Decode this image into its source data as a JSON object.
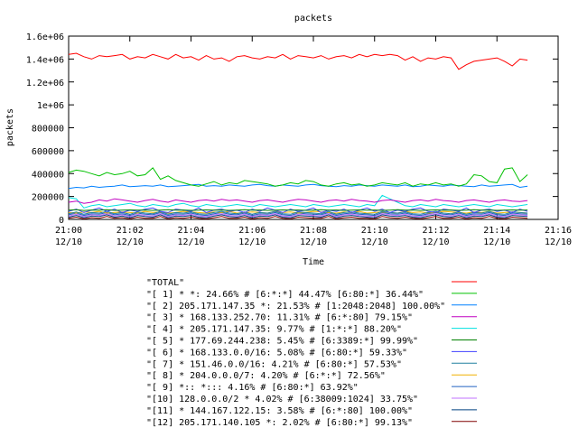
{
  "chart_data": {
    "type": "line",
    "title": "packets",
    "xlabel": "Time",
    "ylabel": "packets",
    "ylim": [
      0,
      1600000
    ],
    "y_ticks": [
      0,
      200000,
      400000,
      600000,
      800000,
      1000000,
      1200000,
      1400000,
      1600000
    ],
    "y_tick_labels": [
      "0",
      "200000",
      "400000",
      "600000",
      "800000",
      "1e+06",
      "1.2e+06",
      "1.4e+06",
      "1.6e+06"
    ],
    "xlim": [
      "21:00",
      "21:16"
    ],
    "x_ticks": [
      {
        "time": "21:00",
        "date": "12/10"
      },
      {
        "time": "21:02",
        "date": "12/10"
      },
      {
        "time": "21:04",
        "date": "12/10"
      },
      {
        "time": "21:06",
        "date": "12/10"
      },
      {
        "time": "21:08",
        "date": "12/10"
      },
      {
        "time": "21:10",
        "date": "12/10"
      },
      {
        "time": "21:12",
        "date": "12/10"
      },
      {
        "time": "21:14",
        "date": "12/10"
      },
      {
        "time": "21:16",
        "date": "12/10"
      }
    ],
    "grid": false,
    "legend_position": "bottom",
    "x_minutes": [
      0,
      0.25,
      0.5,
      0.75,
      1,
      1.25,
      1.5,
      1.75,
      2,
      2.25,
      2.5,
      2.75,
      3,
      3.25,
      3.5,
      3.75,
      4,
      4.25,
      4.5,
      4.75,
      5,
      5.25,
      5.5,
      5.75,
      6,
      6.25,
      6.5,
      6.75,
      7,
      7.25,
      7.5,
      7.75,
      8,
      8.25,
      8.5,
      8.75,
      9,
      9.25,
      9.5,
      9.75,
      10,
      10.25,
      10.5,
      10.75,
      11,
      11.25,
      11.5,
      11.75,
      12,
      12.25,
      12.5,
      12.75,
      13,
      13.25,
      13.5,
      13.75,
      14,
      14.25,
      14.5,
      14.75,
      15
    ],
    "series": [
      {
        "name": "\"TOTAL\"",
        "color": "#ff0000",
        "values": [
          1440000,
          1450000,
          1420000,
          1400000,
          1430000,
          1420000,
          1430000,
          1440000,
          1400000,
          1420000,
          1410000,
          1440000,
          1420000,
          1400000,
          1440000,
          1410000,
          1420000,
          1390000,
          1430000,
          1400000,
          1410000,
          1380000,
          1420000,
          1430000,
          1410000,
          1400000,
          1420000,
          1410000,
          1440000,
          1400000,
          1430000,
          1420000,
          1410000,
          1430000,
          1400000,
          1420000,
          1430000,
          1410000,
          1440000,
          1420000,
          1440000,
          1430000,
          1440000,
          1430000,
          1390000,
          1420000,
          1380000,
          1410000,
          1400000,
          1420000,
          1410000,
          1310000,
          1350000,
          1380000,
          1390000,
          1400000,
          1410000,
          1380000,
          1340000,
          1400000,
          1390000
        ]
      },
      {
        "name": "\"[ 1] * *: 24.66% # [6:*:*] 44.47% [6:80:*] 36.44%\"",
        "color": "#00c000",
        "values": [
          410000,
          430000,
          420000,
          400000,
          380000,
          410000,
          390000,
          400000,
          420000,
          380000,
          390000,
          450000,
          350000,
          380000,
          340000,
          320000,
          300000,
          290000,
          310000,
          330000,
          300000,
          320000,
          310000,
          340000,
          330000,
          320000,
          310000,
          290000,
          300000,
          320000,
          310000,
          340000,
          330000,
          300000,
          290000,
          310000,
          320000,
          300000,
          310000,
          290000,
          300000,
          320000,
          310000,
          300000,
          320000,
          290000,
          310000,
          300000,
          320000,
          300000,
          310000,
          290000,
          310000,
          390000,
          380000,
          330000,
          320000,
          440000,
          450000,
          330000,
          390000
        ]
      },
      {
        "name": "\"[ 2] 205.171.147.35 *: 21.53% # [1:2048:2048] 100.00%\"",
        "color": "#0080ff",
        "values": [
          270000,
          280000,
          275000,
          290000,
          280000,
          285000,
          290000,
          300000,
          285000,
          290000,
          295000,
          290000,
          300000,
          285000,
          290000,
          295000,
          300000,
          305000,
          290000,
          295000,
          290000,
          300000,
          295000,
          290000,
          300000,
          305000,
          295000,
          290000,
          300000,
          295000,
          290000,
          300000,
          305000,
          295000,
          290000,
          285000,
          295000,
          290000,
          300000,
          295000,
          290000,
          300000,
          295000,
          290000,
          300000,
          285000,
          290000,
          300000,
          295000,
          290000,
          300000,
          295000,
          290000,
          285000,
          300000,
          290000,
          295000,
          300000,
          305000,
          280000,
          290000
        ]
      },
      {
        "name": "\"[ 3] * 168.133.252.70: 11.31% # [6:*:80] 79.15%\"",
        "color": "#c000c0",
        "values": [
          150000,
          160000,
          140000,
          150000,
          170000,
          160000,
          180000,
          170000,
          160000,
          150000,
          165000,
          175000,
          160000,
          150000,
          170000,
          160000,
          150000,
          165000,
          170000,
          160000,
          175000,
          165000,
          170000,
          160000,
          150000,
          165000,
          170000,
          160000,
          150000,
          165000,
          175000,
          170000,
          160000,
          150000,
          165000,
          170000,
          160000,
          175000,
          165000,
          160000,
          150000,
          165000,
          170000,
          160000,
          150000,
          165000,
          170000,
          160000,
          175000,
          165000,
          160000,
          150000,
          165000,
          170000,
          160000,
          150000,
          165000,
          170000,
          160000,
          155000,
          165000
        ]
      },
      {
        "name": "\"[ 4] * 205.171.147.35: 9.77% # [1:*:*] 88.20%\"",
        "color": "#00e0e0",
        "values": [
          190000,
          180000,
          100000,
          120000,
          130000,
          110000,
          120000,
          130000,
          140000,
          120000,
          110000,
          130000,
          120000,
          110000,
          130000,
          140000,
          120000,
          110000,
          130000,
          120000,
          110000,
          120000,
          130000,
          120000,
          110000,
          130000,
          120000,
          110000,
          120000,
          130000,
          120000,
          110000,
          130000,
          120000,
          110000,
          120000,
          130000,
          120000,
          110000,
          130000,
          120000,
          210000,
          180000,
          150000,
          120000,
          110000,
          130000,
          120000,
          110000,
          130000,
          120000,
          110000,
          120000,
          130000,
          120000,
          110000,
          130000,
          120000,
          110000,
          120000,
          130000
        ]
      },
      {
        "name": "\"[ 5] * 177.69.244.238: 5.45% # [6:3389:*] 99.99%\"",
        "color": "#008000",
        "values": [
          80000,
          85000,
          78000,
          82000,
          80000,
          84000,
          79000,
          81000,
          83000,
          80000,
          82000,
          79000,
          81000,
          84000,
          80000,
          82000,
          79000,
          81000,
          83000,
          80000,
          82000,
          79000,
          81000,
          84000,
          80000,
          82000,
          79000,
          81000,
          83000,
          80000,
          82000,
          79000,
          81000,
          84000,
          80000,
          82000,
          79000,
          81000,
          83000,
          80000,
          82000,
          79000,
          81000,
          84000,
          80000,
          82000,
          79000,
          81000,
          83000,
          80000,
          82000,
          79000,
          81000,
          84000,
          80000,
          82000,
          79000,
          81000,
          83000,
          80000,
          82000
        ]
      },
      {
        "name": "\"[ 6] * 168.133.0.0/16: 5.08% # [6:80:*] 59.33%\"",
        "color": "#4040ff",
        "values": [
          70000,
          90000,
          60000,
          80000,
          100000,
          70000,
          90000,
          60000,
          80000,
          70000,
          90000,
          100000,
          70000,
          60000,
          90000,
          80000,
          70000,
          100000,
          60000,
          80000,
          90000,
          70000,
          80000,
          60000,
          90000,
          70000,
          100000,
          80000,
          60000,
          90000,
          70000,
          80000,
          100000,
          60000,
          80000,
          70000,
          90000,
          60000,
          80000,
          100000,
          70000,
          90000,
          60000,
          80000,
          70000,
          90000,
          100000,
          70000,
          60000,
          90000,
          80000,
          70000,
          100000,
          60000,
          80000,
          90000,
          70000,
          80000,
          60000,
          90000,
          70000
        ]
      },
      {
        "name": "\"[ 7] * 151.46.0.0/16: 4.21% # [6:80:*] 57.53%\"",
        "color": "#2080a0",
        "values": [
          50000,
          65000,
          45000,
          60000,
          55000,
          70000,
          50000,
          60000,
          45000,
          65000,
          55000,
          50000,
          70000,
          45000,
          60000,
          55000,
          65000,
          50000,
          45000,
          60000,
          70000,
          55000,
          50000,
          65000,
          45000,
          60000,
          55000,
          70000,
          50000,
          45000,
          65000,
          60000,
          55000,
          50000,
          70000,
          45000,
          60000,
          65000,
          55000,
          50000,
          45000,
          70000,
          60000,
          55000,
          65000,
          50000,
          45000,
          60000,
          70000,
          55000,
          50000,
          65000,
          45000,
          60000,
          55000,
          70000,
          50000,
          45000,
          65000,
          60000,
          55000
        ]
      },
      {
        "name": "\"[ 8] * 204.0.0.0/7: 4.20% # [6:*:*] 72.56%\"",
        "color": "#f0b000",
        "values": [
          60000,
          55000,
          65000,
          60000,
          70000,
          55000,
          60000,
          65000,
          60000,
          55000,
          70000,
          60000,
          65000,
          55000,
          60000,
          70000,
          65000,
          60000,
          55000,
          65000,
          60000,
          70000,
          55000,
          60000,
          65000,
          60000,
          55000,
          70000,
          60000,
          65000,
          55000,
          60000,
          70000,
          65000,
          60000,
          55000,
          65000,
          60000,
          70000,
          55000,
          60000,
          65000,
          60000,
          55000,
          70000,
          60000,
          65000,
          55000,
          60000,
          70000,
          65000,
          60000,
          55000,
          65000,
          60000,
          70000,
          55000,
          60000,
          65000,
          60000,
          55000
        ]
      },
      {
        "name": "\"[ 9] *:: *::: 4.16% # [6:80:*] 63.92%\"",
        "color": "#2060c0",
        "values": [
          40000,
          55000,
          35000,
          50000,
          45000,
          60000,
          40000,
          50000,
          35000,
          55000,
          45000,
          40000,
          60000,
          35000,
          50000,
          45000,
          55000,
          40000,
          35000,
          50000,
          60000,
          45000,
          40000,
          55000,
          35000,
          50000,
          45000,
          60000,
          40000,
          35000,
          55000,
          50000,
          45000,
          40000,
          60000,
          35000,
          50000,
          55000,
          45000,
          40000,
          35000,
          60000,
          50000,
          45000,
          55000,
          40000,
          35000,
          50000,
          60000,
          45000,
          40000,
          55000,
          35000,
          50000,
          45000,
          60000,
          40000,
          35000,
          55000,
          50000,
          45000
        ]
      },
      {
        "name": "\"[10] 128.0.0.0/2 * 4.02% # [6:38009:1024] 33.75%\"",
        "color": "#c070ff",
        "values": [
          30000,
          45000,
          25000,
          40000,
          35000,
          50000,
          30000,
          40000,
          25000,
          45000,
          35000,
          30000,
          50000,
          25000,
          40000,
          35000,
          45000,
          30000,
          25000,
          40000,
          50000,
          35000,
          30000,
          45000,
          25000,
          40000,
          35000,
          50000,
          30000,
          25000,
          45000,
          40000,
          35000,
          30000,
          50000,
          25000,
          40000,
          45000,
          35000,
          30000,
          25000,
          50000,
          40000,
          35000,
          45000,
          30000,
          25000,
          40000,
          50000,
          35000,
          30000,
          45000,
          25000,
          40000,
          35000,
          50000,
          30000,
          25000,
          45000,
          40000,
          35000
        ]
      },
      {
        "name": "\"[11] * 144.167.122.15: 3.58% # [6:*:80] 100.00%\"",
        "color": "#004080",
        "values": [
          20000,
          35000,
          15000,
          30000,
          25000,
          40000,
          20000,
          30000,
          15000,
          35000,
          25000,
          20000,
          40000,
          15000,
          30000,
          25000,
          35000,
          20000,
          15000,
          30000,
          40000,
          25000,
          20000,
          35000,
          15000,
          30000,
          25000,
          40000,
          20000,
          15000,
          35000,
          30000,
          25000,
          20000,
          40000,
          15000,
          30000,
          35000,
          25000,
          20000,
          15000,
          40000,
          30000,
          25000,
          35000,
          20000,
          15000,
          30000,
          40000,
          25000,
          20000,
          35000,
          15000,
          30000,
          25000,
          40000,
          20000,
          15000,
          35000,
          30000,
          25000
        ]
      },
      {
        "name": "\"[12] 205.171.140.105 *: 2.02% # [6:80:*] 99.13%\"",
        "color": "#800000",
        "values": [
          10000,
          20000,
          5000,
          15000,
          10000,
          25000,
          10000,
          15000,
          5000,
          20000,
          10000,
          10000,
          25000,
          5000,
          15000,
          10000,
          20000,
          10000,
          5000,
          15000,
          25000,
          10000,
          10000,
          20000,
          5000,
          15000,
          10000,
          25000,
          10000,
          5000,
          20000,
          15000,
          10000,
          10000,
          25000,
          5000,
          15000,
          20000,
          10000,
          10000,
          5000,
          25000,
          15000,
          10000,
          20000,
          10000,
          5000,
          15000,
          25000,
          10000,
          10000,
          20000,
          5000,
          15000,
          10000,
          25000,
          10000,
          5000,
          20000,
          15000,
          10000
        ]
      }
    ]
  }
}
